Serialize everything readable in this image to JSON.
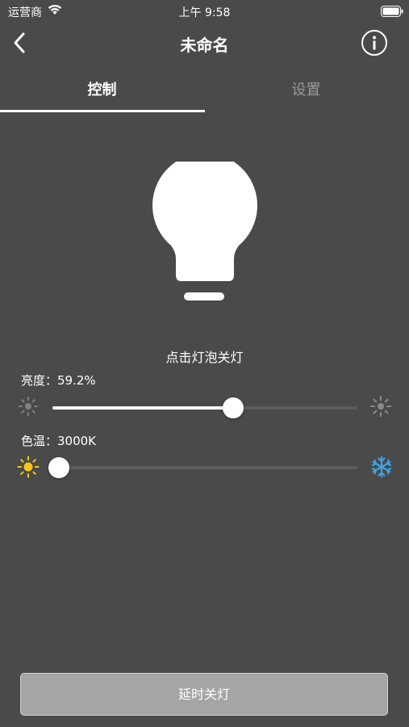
{
  "status_bar": {
    "carrier": "运营商",
    "time": "上午 9:58"
  },
  "nav": {
    "title": "未命名"
  },
  "tabs": [
    {
      "label": "控制",
      "active": true
    },
    {
      "label": "设置",
      "active": false
    }
  ],
  "bulb": {
    "hint": "点击灯泡关灯",
    "state": "on"
  },
  "brightness": {
    "label": "亮度：59.2%",
    "value": 0.592
  },
  "color_temp": {
    "label": "色温：3000K",
    "value": 0.02
  },
  "bottom": {
    "delay_label": "延时关灯"
  },
  "colors": {
    "background": "#4a4a4a",
    "sun": "#f5c518",
    "snow": "#3aa3e8",
    "button": "#a5a5a5"
  }
}
